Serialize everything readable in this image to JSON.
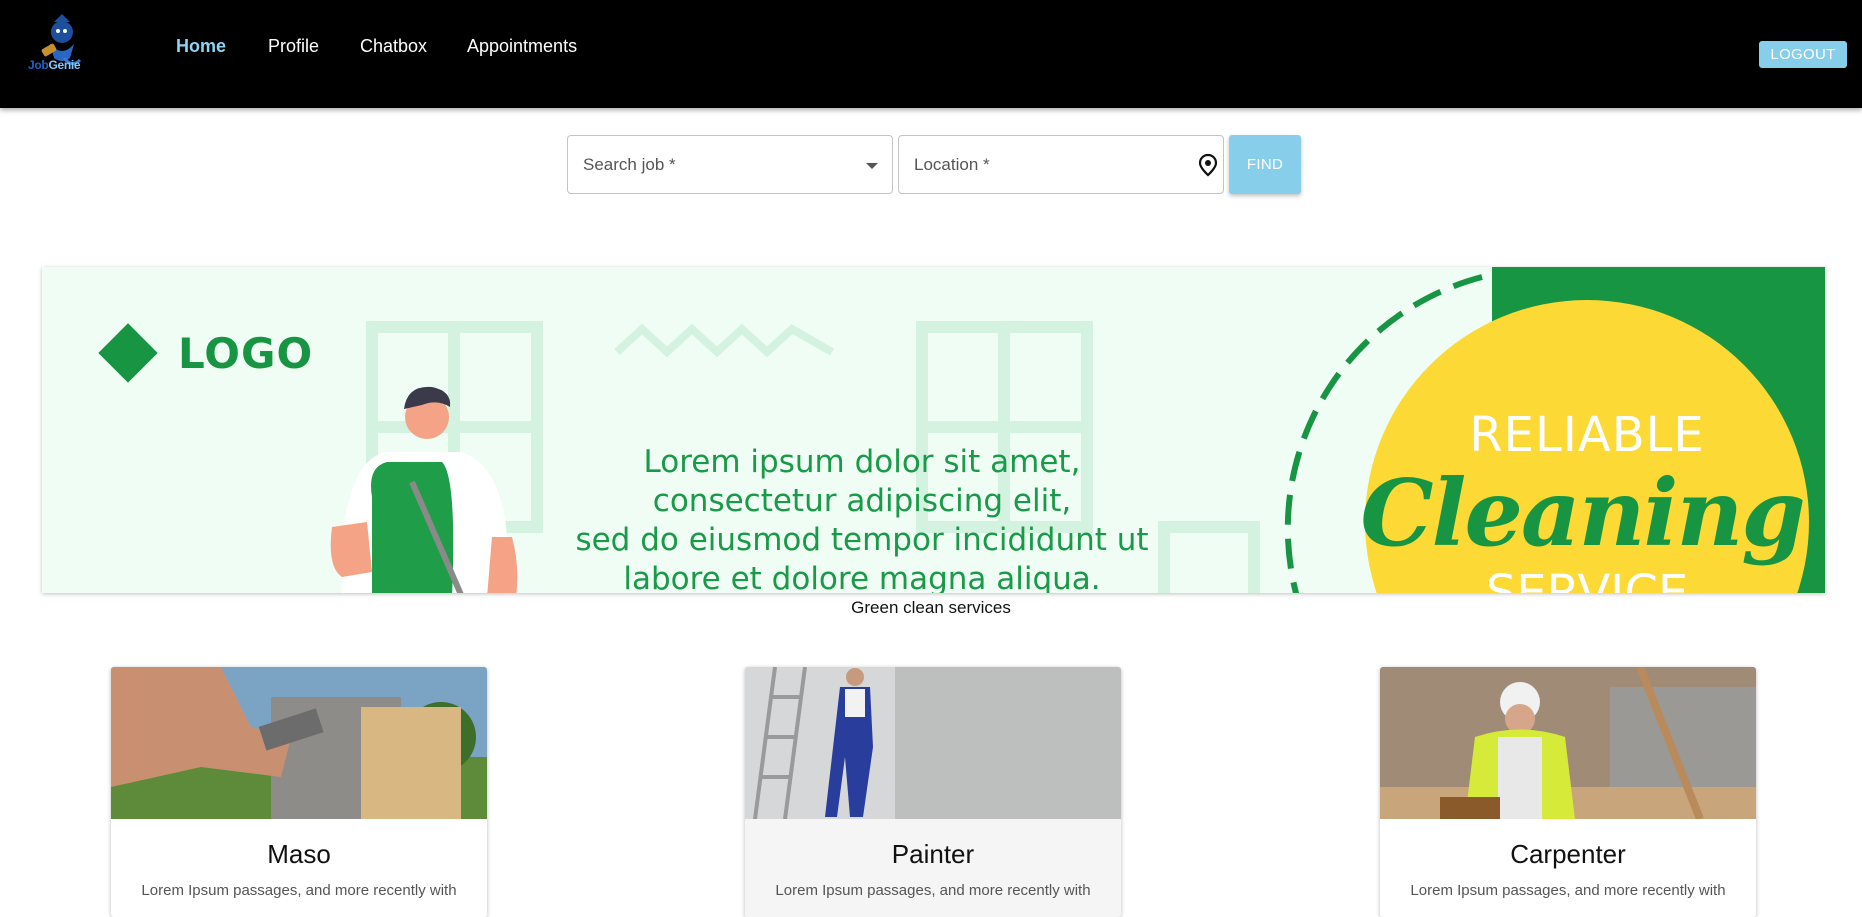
{
  "brand": {
    "name_part1": "Job",
    "name_part2": "Genie",
    "icon": "genie-logo-icon"
  },
  "nav": {
    "items": [
      {
        "label": "Home",
        "active": true
      },
      {
        "label": "Profile",
        "active": false
      },
      {
        "label": "Chatbox",
        "active": false
      },
      {
        "label": "Appointments",
        "active": false
      }
    ]
  },
  "header": {
    "logout_label": "LOGOUT"
  },
  "search": {
    "job_placeholder": "Search job *",
    "location_placeholder": "Location *",
    "find_label": "FIND",
    "location_icon": "location-pin-icon",
    "dropdown_icon": "caret-down-icon"
  },
  "banner": {
    "logo_text": "LOGO",
    "text_lines": [
      "Lorem ipsum dolor sit amet,",
      "consectetur adipiscing elit,",
      "sed do eiusmod tempor incididunt ut",
      "labore et dolore magna aliqua."
    ],
    "badge_line1": "RELIABLE",
    "badge_line2": "Cleaning",
    "badge_line3": "SERVICE",
    "caption": "Green clean services"
  },
  "cards": [
    {
      "title": "Maso",
      "description": "Lorem Ipsum passages, and more recently with"
    },
    {
      "title": "Painter",
      "description": "Lorem Ipsum passages, and more recently with"
    },
    {
      "title": "Carpenter",
      "description": "Lorem Ipsum passages, and more recently with"
    }
  ],
  "colors": {
    "header_bg": "#000000",
    "accent": "#87ceeb",
    "active_nav": "#8fd3f4",
    "banner_green": "#189543",
    "banner_yellow": "#fcd934"
  }
}
